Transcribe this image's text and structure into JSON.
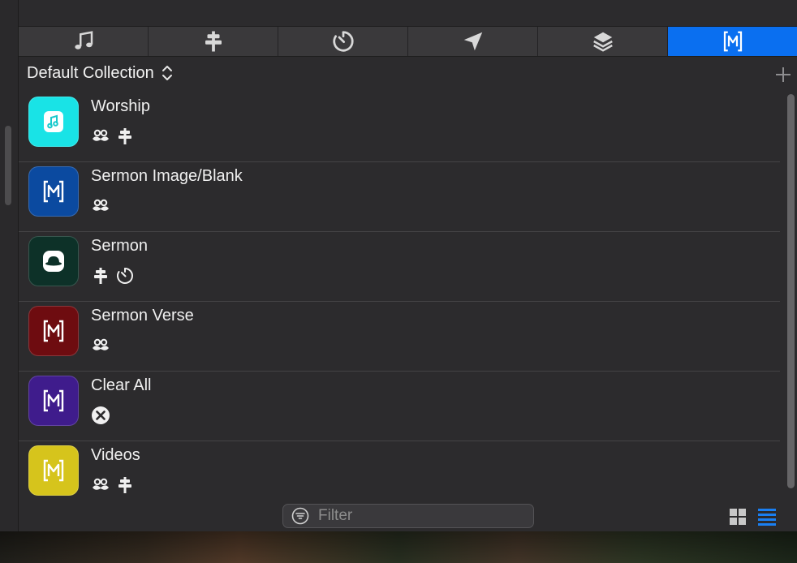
{
  "tabs": [
    {
      "icon": "music-note-icon",
      "active": false
    },
    {
      "icon": "stage-sign-icon",
      "active": false
    },
    {
      "icon": "timer-icon",
      "active": false
    },
    {
      "icon": "send-arrow-icon",
      "active": false
    },
    {
      "icon": "layers-icon",
      "active": false
    },
    {
      "icon": "macro-bracket-m-icon",
      "active": true
    }
  ],
  "collection": {
    "label": "Default Collection"
  },
  "macros": [
    {
      "title": "Worship",
      "icon": "music-document-icon",
      "color": "#19e3e6",
      "badges": [
        "mustache-icon",
        "stage-sign-icon"
      ]
    },
    {
      "title": "Sermon Image/Blank",
      "icon": "bracket-m-icon",
      "color": "#0b4aa0",
      "badges": [
        "mustache-icon"
      ]
    },
    {
      "title": "Sermon",
      "icon": "hat-icon",
      "color": "#0d3128",
      "badges": [
        "stage-sign-icon",
        "timer-icon"
      ]
    },
    {
      "title": "Sermon Verse",
      "icon": "bracket-m-icon",
      "color": "#6e0c10",
      "badges": [
        "mustache-icon"
      ]
    },
    {
      "title": "Clear All",
      "icon": "bracket-m-icon",
      "color": "#3f1c8c",
      "badges": [
        "clear-x-icon"
      ]
    },
    {
      "title": "Videos",
      "icon": "bracket-m-icon",
      "color": "#d6c41c",
      "badges": [
        "mustache-icon",
        "stage-sign-icon"
      ]
    }
  ],
  "filter": {
    "placeholder": "Filter"
  },
  "colors": {
    "accent": "#0a6ff0",
    "panel": "#2c2b2d",
    "tab": "#3a393b"
  },
  "view_mode": "list"
}
